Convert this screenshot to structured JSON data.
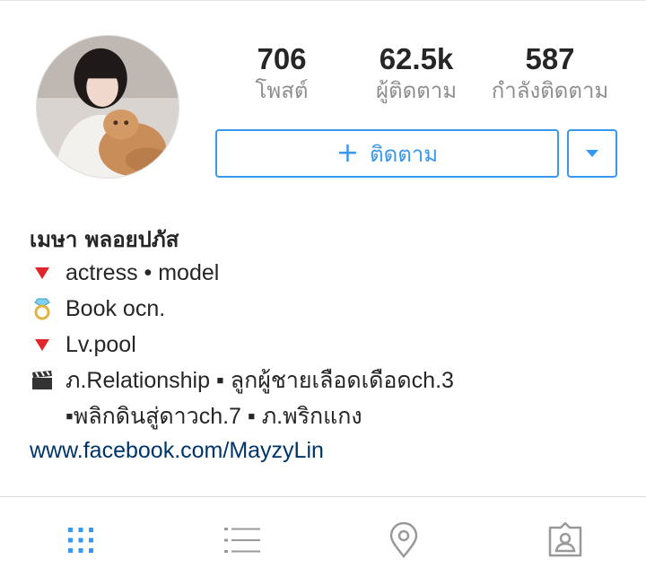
{
  "profile": {
    "name": "เมษา พลอยปภัส",
    "avatar_alt": "profile-photo"
  },
  "stats": {
    "posts": {
      "value": "706",
      "label": "โพสต์"
    },
    "followers": {
      "value": "62.5k",
      "label": "ผู้ติดตาม"
    },
    "following": {
      "value": "587",
      "label": "กำลังติดตาม"
    }
  },
  "actions": {
    "follow_label": "ติดตาม",
    "follow_plus": "+"
  },
  "bio": {
    "lines": [
      {
        "icon": "red-triangle-icon",
        "text": "actress • model"
      },
      {
        "icon": "ring-icon",
        "text": "Book ocn."
      },
      {
        "icon": "red-triangle-icon",
        "text": "Lv.pool"
      },
      {
        "icon": "clapper-board-icon",
        "text": "ภ.Relationship ▪ ลูกผู้ชายเลือดเดือดch.3"
      },
      {
        "icon": "",
        "text": "▪พลิกดินสู่ดาวch.7 ▪ ภ.พริกแกง"
      }
    ],
    "link": "www.facebook.com/MayzyLin"
  },
  "tabs": [
    "grid-icon",
    "list-icon",
    "location-pin-icon",
    "tagged-photos-icon"
  ],
  "colors": {
    "accent": "#3897f0",
    "link": "#003569",
    "muted": "#8e8e8e",
    "text": "#262626"
  }
}
